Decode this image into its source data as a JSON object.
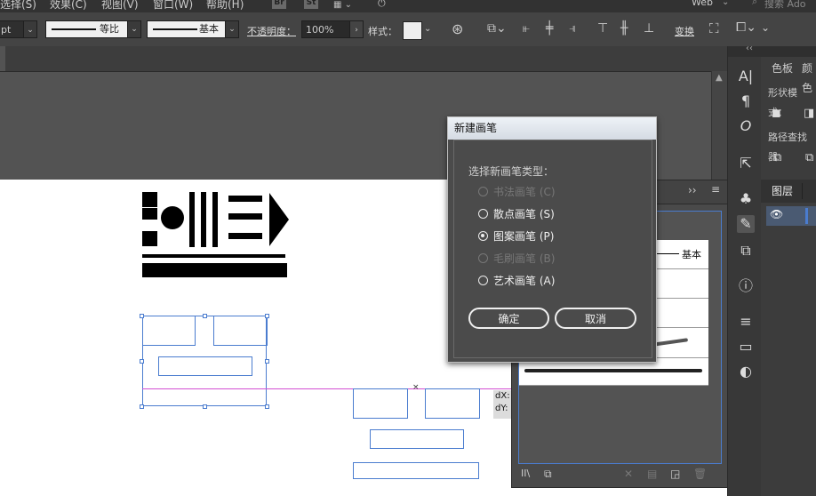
{
  "menubar": {
    "items": [
      "选择(S)",
      "效果(C)",
      "视图(V)",
      "窗口(W)",
      "帮助(H)"
    ],
    "badges": [
      "Br",
      "St"
    ],
    "workspace": "Web",
    "search_placeholder": "搜索 Ado"
  },
  "controlbar": {
    "unit_value": "pt",
    "stroke_profile_label": "等比",
    "brush_label": "基本",
    "opacity_label": "不透明度：",
    "opacity_value": "100%",
    "style_label": "样式：",
    "transform_label": "变换"
  },
  "right_panels": {
    "tabs_top": [
      "色板",
      "颜色"
    ],
    "shape_modes_label": "形状模式：",
    "pathfinder_label": "路径查找器",
    "layers_tab": "图层"
  },
  "brushes_panel": {
    "first_row_label": "基本"
  },
  "selection_readout": {
    "dx_label": "dX:",
    "dy_label": "dY:"
  },
  "dialog": {
    "title": "新建画笔",
    "prompt": "选择新画笔类型：",
    "options": [
      {
        "label": "书法画笔 (C)",
        "enabled": false,
        "selected": false
      },
      {
        "label": "散点画笔 (S)",
        "enabled": true,
        "selected": false
      },
      {
        "label": "图案画笔 (P)",
        "enabled": true,
        "selected": true
      },
      {
        "label": "毛刷画笔 (B)",
        "enabled": false,
        "selected": false
      },
      {
        "label": "艺术画笔 (A)",
        "enabled": true,
        "selected": false
      }
    ],
    "ok_label": "确定",
    "cancel_label": "取消"
  },
  "colors": {
    "selection_blue": "#4a7ccf",
    "guide_magenta": "#d24fd2",
    "ui_dark": "#535353"
  }
}
